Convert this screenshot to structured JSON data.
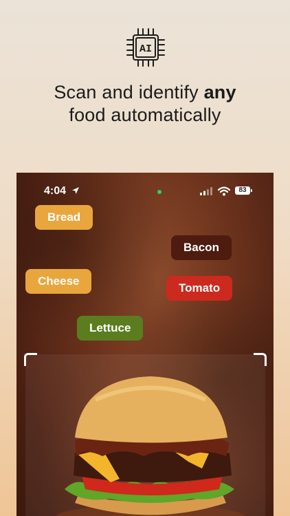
{
  "chip_label": "AI",
  "headline": {
    "line1_prefix": "Scan and identify ",
    "line1_bold": "any",
    "line2": "food automatically"
  },
  "status_bar": {
    "time": "4:04",
    "battery": "83"
  },
  "tags": {
    "bread": "Bread",
    "bacon": "Bacon",
    "cheese": "Cheese",
    "tomato": "Tomato",
    "lettuce": "Lettuce"
  },
  "colors": {
    "bread_tag": "#e9a63c",
    "cheese_tag": "#e9a63c",
    "bacon_tag": "#4e1c0f",
    "tomato_tag": "#cc2a1e",
    "lettuce_tag": "#5b7d20",
    "camera_dot": "#31d158"
  },
  "icons": [
    "ai-chip-icon",
    "location-arrow-icon",
    "signal-icon",
    "wifi-icon",
    "battery-icon"
  ]
}
